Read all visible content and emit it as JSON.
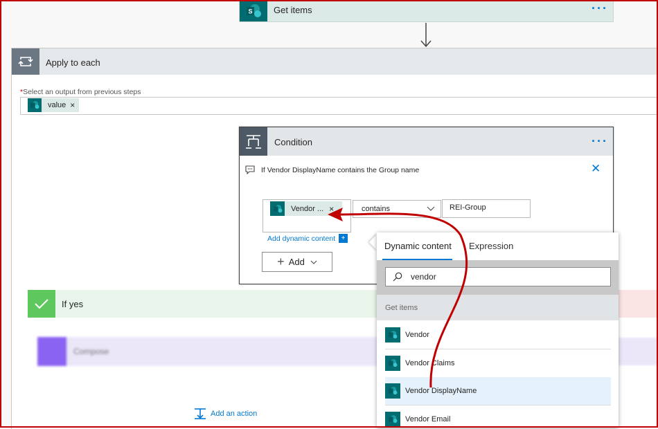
{
  "get_items": {
    "title": "Get items",
    "more": "···",
    "icon": "sharepoint-icon"
  },
  "apply_to_each": {
    "title": "Apply to each",
    "required_marker": "*",
    "field_label": "Select an output from previous steps",
    "token": {
      "label": "value",
      "remove": "×"
    }
  },
  "condition": {
    "title": "Condition",
    "more": "···",
    "comment": "If Vendor DisplayName contains the Group name",
    "close": "✕",
    "left_token": {
      "label": "Vendor ...",
      "remove": "×"
    },
    "operator": "contains",
    "value": "REI-Group",
    "add_dynamic": "Add dynamic content",
    "add_dynamic_badge": "+",
    "add_button": "Add"
  },
  "if_yes": {
    "title": "If yes",
    "compose": "Compose",
    "add_action": "Add an action"
  },
  "dynamic_panel": {
    "tabs": [
      "Dynamic content",
      "Expression"
    ],
    "search_value": "vendor",
    "group": "Get items",
    "items": [
      "Vendor",
      "Vendor Claims",
      "Vendor DisplayName",
      "Vendor Email"
    ],
    "selected_index": 2
  },
  "colors": {
    "accent": "#0078d4",
    "sharepoint": "#036c70",
    "annotation": "#c00000",
    "condition_header": "#4d5a66",
    "if_yes": "#5ec75e"
  }
}
